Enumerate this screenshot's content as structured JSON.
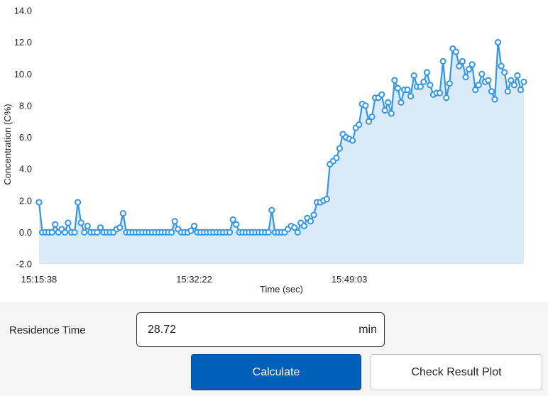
{
  "chart_data": {
    "type": "line",
    "title": "",
    "xlabel": "Time (sec)",
    "ylabel": "Concentration (C%)",
    "ylim": [
      -2.0,
      14.0
    ],
    "y_ticks": [
      "-2.0",
      "0.0",
      "2.0",
      "4.0",
      "6.0",
      "8.0",
      "10.0",
      "12.0",
      "14.0"
    ],
    "x_tick_labels": [
      "15:15:38",
      "15:32:22",
      "15:49:03"
    ],
    "x_tick_indices": [
      0,
      48,
      96
    ],
    "grid": false,
    "legend": "none",
    "series": [
      {
        "values": [
          1.9,
          0.0,
          0.0,
          0.0,
          0.0,
          0.5,
          0.0,
          0.2,
          0.0,
          0.6,
          0.0,
          0.0,
          1.9,
          0.6,
          0.0,
          0.4,
          0.0,
          0.0,
          0.0,
          0.3,
          0.0,
          0.0,
          0.0,
          0.0,
          0.2,
          0.3,
          1.2,
          0.0,
          0.0,
          0.0,
          0.0,
          0.0,
          0.0,
          0.0,
          0.0,
          0.0,
          0.0,
          0.0,
          0.0,
          0.0,
          0.0,
          0.0,
          0.7,
          0.2,
          0.0,
          0.0,
          0.0,
          0.1,
          0.4,
          0.0,
          0.0,
          0.0,
          0.0,
          0.0,
          0.0,
          0.0,
          0.0,
          0.0,
          0.0,
          0.0,
          0.8,
          0.5,
          0.0,
          0.0,
          0.0,
          0.0,
          0.0,
          0.0,
          0.0,
          0.0,
          0.0,
          0.0,
          1.4,
          0.0,
          0.0,
          0.0,
          0.0,
          0.2,
          0.4,
          0.3,
          0.0,
          0.6,
          0.4,
          0.9,
          0.7,
          1.1,
          1.9,
          1.9,
          2.0,
          2.1,
          4.3,
          4.5,
          4.7,
          5.3,
          6.2,
          6.0,
          5.9,
          5.8,
          6.6,
          6.8,
          8.1,
          8.0,
          7.0,
          7.3,
          8.5,
          8.5,
          8.7,
          7.7,
          8.2,
          7.5,
          9.6,
          9.1,
          8.2,
          9.0,
          9.0,
          8.6,
          9.9,
          9.2,
          9.2,
          9.5,
          10.1,
          9.3,
          8.7,
          8.8,
          8.8,
          10.8,
          8.5,
          9.4,
          11.6,
          11.4,
          10.5,
          10.8,
          9.8,
          10.3,
          10.6,
          9.0,
          9.3,
          10.0,
          9.5,
          9.6,
          8.9,
          8.4,
          12.0,
          10.5,
          10.1,
          8.9,
          9.6,
          9.3,
          9.9,
          9.0,
          9.5
        ]
      }
    ],
    "colors": {
      "line": "#3396e6",
      "fill": "#daeaf9",
      "marker_fill": "#ffffff"
    }
  },
  "form": {
    "residence_label": "Residence Time",
    "residence_value": "28.72",
    "residence_unit": "min",
    "calculate_label": "Calculate",
    "check_plot_label": "Check Result Plot"
  },
  "colors": {
    "primary_button": "#005fb8"
  }
}
